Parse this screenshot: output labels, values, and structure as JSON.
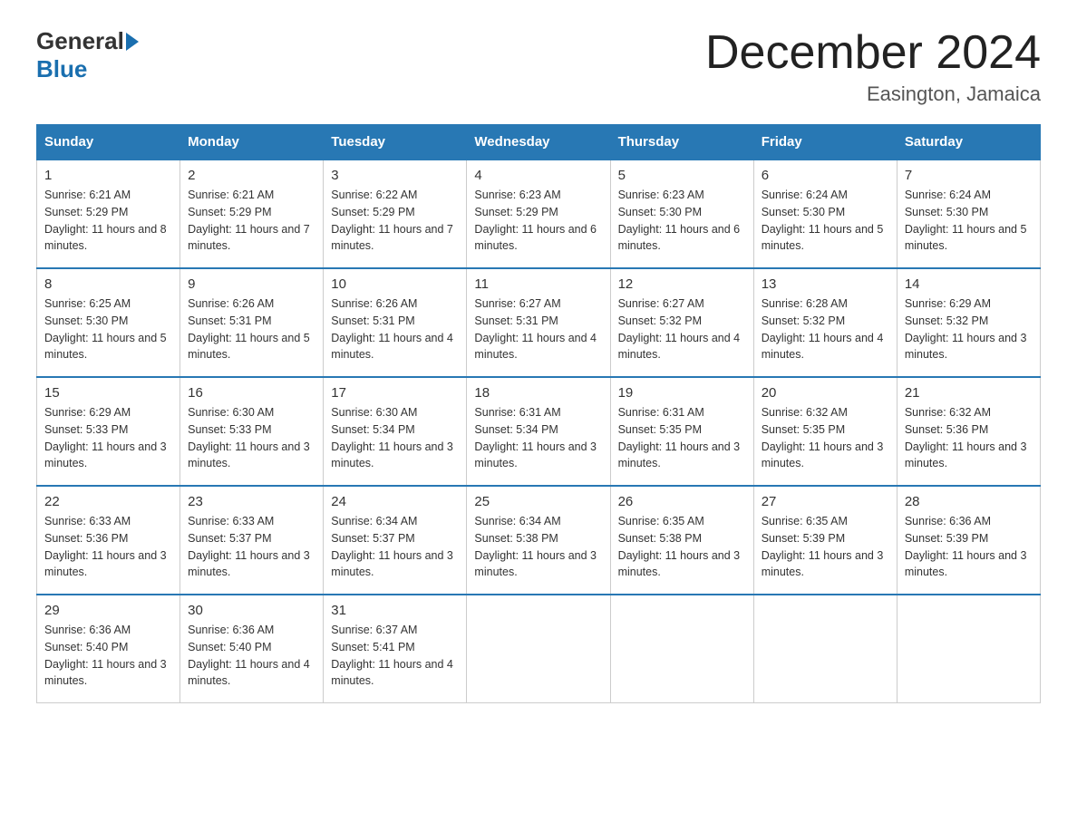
{
  "header": {
    "logo_general": "General",
    "logo_blue": "Blue",
    "month_title": "December 2024",
    "location": "Easington, Jamaica"
  },
  "weekdays": [
    "Sunday",
    "Monday",
    "Tuesday",
    "Wednesday",
    "Thursday",
    "Friday",
    "Saturday"
  ],
  "weeks": [
    [
      {
        "day": "1",
        "sunrise": "6:21 AM",
        "sunset": "5:29 PM",
        "daylight": "11 hours and 8 minutes."
      },
      {
        "day": "2",
        "sunrise": "6:21 AM",
        "sunset": "5:29 PM",
        "daylight": "11 hours and 7 minutes."
      },
      {
        "day": "3",
        "sunrise": "6:22 AM",
        "sunset": "5:29 PM",
        "daylight": "11 hours and 7 minutes."
      },
      {
        "day": "4",
        "sunrise": "6:23 AM",
        "sunset": "5:29 PM",
        "daylight": "11 hours and 6 minutes."
      },
      {
        "day": "5",
        "sunrise": "6:23 AM",
        "sunset": "5:30 PM",
        "daylight": "11 hours and 6 minutes."
      },
      {
        "day": "6",
        "sunrise": "6:24 AM",
        "sunset": "5:30 PM",
        "daylight": "11 hours and 5 minutes."
      },
      {
        "day": "7",
        "sunrise": "6:24 AM",
        "sunset": "5:30 PM",
        "daylight": "11 hours and 5 minutes."
      }
    ],
    [
      {
        "day": "8",
        "sunrise": "6:25 AM",
        "sunset": "5:30 PM",
        "daylight": "11 hours and 5 minutes."
      },
      {
        "day": "9",
        "sunrise": "6:26 AM",
        "sunset": "5:31 PM",
        "daylight": "11 hours and 5 minutes."
      },
      {
        "day": "10",
        "sunrise": "6:26 AM",
        "sunset": "5:31 PM",
        "daylight": "11 hours and 4 minutes."
      },
      {
        "day": "11",
        "sunrise": "6:27 AM",
        "sunset": "5:31 PM",
        "daylight": "11 hours and 4 minutes."
      },
      {
        "day": "12",
        "sunrise": "6:27 AM",
        "sunset": "5:32 PM",
        "daylight": "11 hours and 4 minutes."
      },
      {
        "day": "13",
        "sunrise": "6:28 AM",
        "sunset": "5:32 PM",
        "daylight": "11 hours and 4 minutes."
      },
      {
        "day": "14",
        "sunrise": "6:29 AM",
        "sunset": "5:32 PM",
        "daylight": "11 hours and 3 minutes."
      }
    ],
    [
      {
        "day": "15",
        "sunrise": "6:29 AM",
        "sunset": "5:33 PM",
        "daylight": "11 hours and 3 minutes."
      },
      {
        "day": "16",
        "sunrise": "6:30 AM",
        "sunset": "5:33 PM",
        "daylight": "11 hours and 3 minutes."
      },
      {
        "day": "17",
        "sunrise": "6:30 AM",
        "sunset": "5:34 PM",
        "daylight": "11 hours and 3 minutes."
      },
      {
        "day": "18",
        "sunrise": "6:31 AM",
        "sunset": "5:34 PM",
        "daylight": "11 hours and 3 minutes."
      },
      {
        "day": "19",
        "sunrise": "6:31 AM",
        "sunset": "5:35 PM",
        "daylight": "11 hours and 3 minutes."
      },
      {
        "day": "20",
        "sunrise": "6:32 AM",
        "sunset": "5:35 PM",
        "daylight": "11 hours and 3 minutes."
      },
      {
        "day": "21",
        "sunrise": "6:32 AM",
        "sunset": "5:36 PM",
        "daylight": "11 hours and 3 minutes."
      }
    ],
    [
      {
        "day": "22",
        "sunrise": "6:33 AM",
        "sunset": "5:36 PM",
        "daylight": "11 hours and 3 minutes."
      },
      {
        "day": "23",
        "sunrise": "6:33 AM",
        "sunset": "5:37 PM",
        "daylight": "11 hours and 3 minutes."
      },
      {
        "day": "24",
        "sunrise": "6:34 AM",
        "sunset": "5:37 PM",
        "daylight": "11 hours and 3 minutes."
      },
      {
        "day": "25",
        "sunrise": "6:34 AM",
        "sunset": "5:38 PM",
        "daylight": "11 hours and 3 minutes."
      },
      {
        "day": "26",
        "sunrise": "6:35 AM",
        "sunset": "5:38 PM",
        "daylight": "11 hours and 3 minutes."
      },
      {
        "day": "27",
        "sunrise": "6:35 AM",
        "sunset": "5:39 PM",
        "daylight": "11 hours and 3 minutes."
      },
      {
        "day": "28",
        "sunrise": "6:36 AM",
        "sunset": "5:39 PM",
        "daylight": "11 hours and 3 minutes."
      }
    ],
    [
      {
        "day": "29",
        "sunrise": "6:36 AM",
        "sunset": "5:40 PM",
        "daylight": "11 hours and 3 minutes."
      },
      {
        "day": "30",
        "sunrise": "6:36 AM",
        "sunset": "5:40 PM",
        "daylight": "11 hours and 4 minutes."
      },
      {
        "day": "31",
        "sunrise": "6:37 AM",
        "sunset": "5:41 PM",
        "daylight": "11 hours and 4 minutes."
      },
      null,
      null,
      null,
      null
    ]
  ]
}
